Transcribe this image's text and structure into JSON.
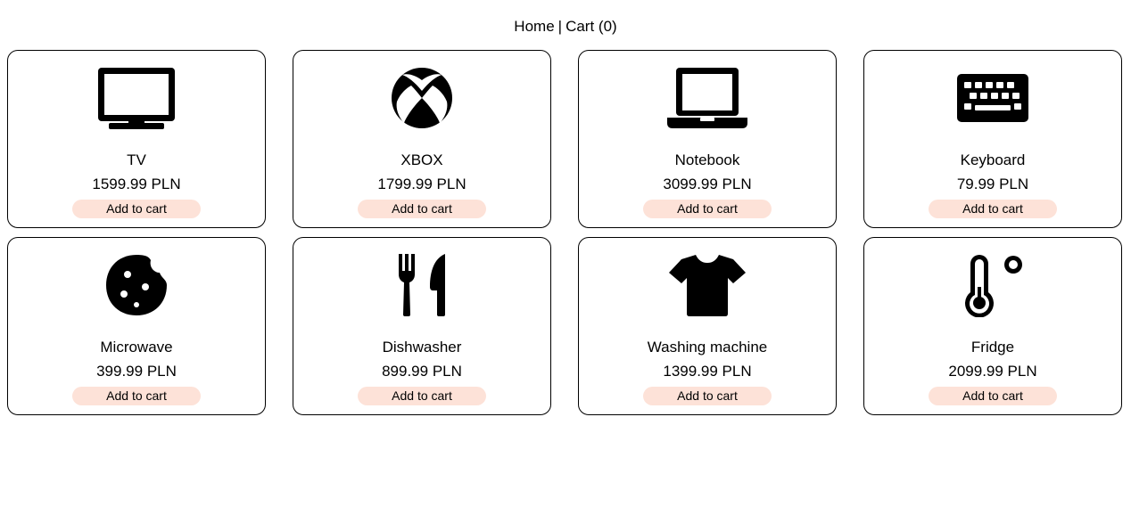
{
  "nav": {
    "home_label": "Home",
    "separator": "|",
    "cart_label": "Cart (0)"
  },
  "colors": {
    "button_background": "#fde2d8",
    "card_border": "#000000"
  },
  "products": [
    {
      "name": "TV",
      "price": "1599.99 PLN",
      "button": "Add to cart",
      "icon": "tv-icon"
    },
    {
      "name": "XBOX",
      "price": "1799.99 PLN",
      "button": "Add to cart",
      "icon": "xbox-icon"
    },
    {
      "name": "Notebook",
      "price": "3099.99 PLN",
      "button": "Add to cart",
      "icon": "laptop-icon"
    },
    {
      "name": "Keyboard",
      "price": "79.99 PLN",
      "button": "Add to cart",
      "icon": "keyboard-icon"
    },
    {
      "name": "Microwave",
      "price": "399.99 PLN",
      "button": "Add to cart",
      "icon": "cookie-icon"
    },
    {
      "name": "Dishwasher",
      "price": "899.99 PLN",
      "button": "Add to cart",
      "icon": "utensils-icon"
    },
    {
      "name": "Washing machine",
      "price": "1399.99 PLN",
      "button": "Add to cart",
      "icon": "shirt-icon"
    },
    {
      "name": "Fridge",
      "price": "2099.99 PLN",
      "button": "Add to cart",
      "icon": "thermometer-icon"
    }
  ]
}
